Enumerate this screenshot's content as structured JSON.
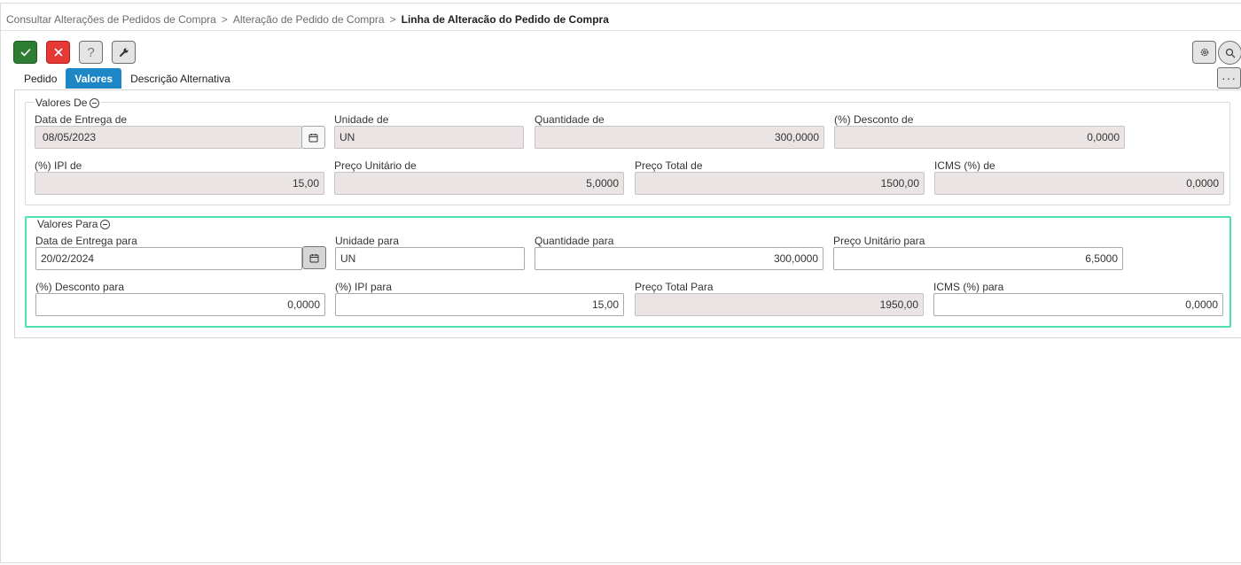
{
  "breadcrumb": {
    "items": [
      "Consultar Alterações de Pedidos de Compra",
      "Alteração de Pedido de Compra"
    ],
    "separator": ">",
    "current": "Linha de Alteracão do Pedido de Compra"
  },
  "toolbar": {
    "help_label": "?",
    "more_label": "···"
  },
  "tabs": [
    {
      "label": "Pedido",
      "active": false
    },
    {
      "label": "Valores",
      "active": true
    },
    {
      "label": "Descrição Alternativa",
      "active": false
    }
  ],
  "valores_de": {
    "legend": "Valores De",
    "data_entrega": {
      "label": "Data de Entrega de",
      "value": "08/05/2023"
    },
    "unidade": {
      "label": "Unidade de",
      "value": "UN"
    },
    "quantidade": {
      "label": "Quantidade de",
      "value": "300,0000"
    },
    "desconto": {
      "label": "(%) Desconto de",
      "value": "0,0000"
    },
    "ipi": {
      "label": "(%) IPI de",
      "value": "15,00"
    },
    "preco_unitario": {
      "label": "Preço Unitário de",
      "value": "5,0000"
    },
    "preco_total": {
      "label": "Preço Total de",
      "value": "1500,00"
    },
    "icms": {
      "label": "ICMS (%) de",
      "value": "0,0000"
    }
  },
  "valores_para": {
    "legend": "Valores Para",
    "data_entrega": {
      "label": "Data de Entrega para",
      "value": "20/02/2024"
    },
    "unidade": {
      "label": "Unidade para",
      "value": "UN"
    },
    "quantidade": {
      "label": "Quantidade para",
      "value": "300,0000"
    },
    "preco_unitario": {
      "label": "Preço Unitário para",
      "value": "6,5000"
    },
    "desconto": {
      "label": "(%) Desconto para",
      "value": "0,0000"
    },
    "ipi": {
      "label": "(%) IPI para",
      "value": "15,00"
    },
    "preco_total": {
      "label": "Preço Total Para",
      "value": "1950,00"
    },
    "icms": {
      "label": "ICMS (%) para",
      "value": "0,0000"
    }
  },
  "colors": {
    "ok_button": "#2e7d32",
    "cancel_button": "#e53935",
    "active_tab": "#1c86c7",
    "readonly_field": "#ebe4e4",
    "focus_group_border": "#4ee0b5"
  }
}
